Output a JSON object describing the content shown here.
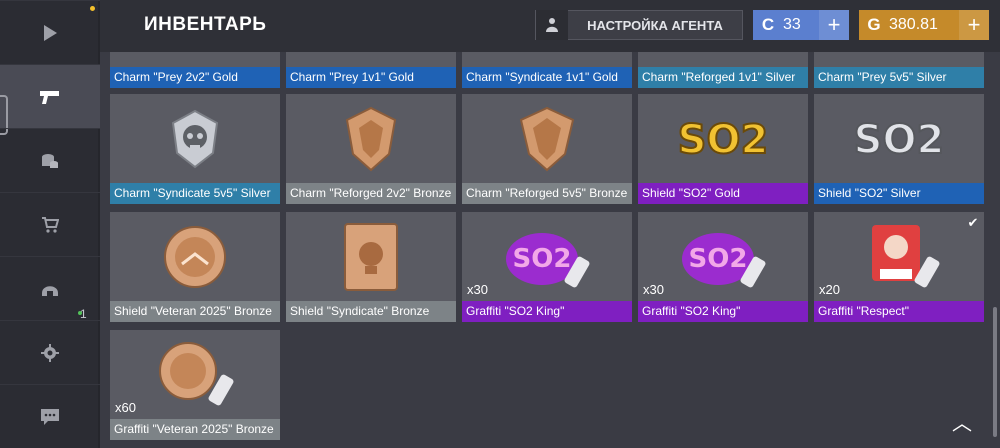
{
  "header": {
    "title": "ИНВЕНТАРЬ",
    "agent_button": "НАСТРОЙКА АГЕНТА",
    "currency_blue": "33",
    "currency_gold": "380.81",
    "blue_symbol": "C",
    "gold_symbol": "G",
    "plus": "+"
  },
  "sidebar": {
    "badge": "1",
    "items": [
      {
        "icon": "play-icon"
      },
      {
        "icon": "pistol-icon"
      },
      {
        "icon": "coins-icon"
      },
      {
        "icon": "cart-icon"
      },
      {
        "icon": "helmet-icon"
      },
      {
        "icon": "gear-icon"
      },
      {
        "icon": "chat-icon"
      }
    ]
  },
  "items_partial": [
    {
      "label": "Charm \"Prey 2v2\" Gold",
      "color": "#1f62b5"
    },
    {
      "label": "Charm \"Prey 1v1\" Gold",
      "color": "#1f62b5"
    },
    {
      "label": "Charm \"Syndicate 1v1\" Gold",
      "color": "#1f62b5"
    },
    {
      "label": "Charm \"Reforged 1v1\" Silver",
      "color": "#2f7fa8"
    },
    {
      "label": "Charm \"Prey 5v5\" Silver",
      "color": "#2f7fa8"
    }
  ],
  "items": [
    {
      "label": "Charm \"Syndicate 5v5\" Silver",
      "color": "#2f7fa8",
      "art": "silver-skull-charm",
      "qty": "",
      "check": ""
    },
    {
      "label": "Charm \"Reforged 2v2\" Bronze",
      "color": "#7d8387",
      "art": "bronze-shield-charm",
      "qty": "",
      "check": ""
    },
    {
      "label": "Charm \"Reforged 5v5\" Bronze",
      "color": "#7d8387",
      "art": "bronze-shield-charm",
      "qty": "",
      "check": ""
    },
    {
      "label": "Shield \"SO2\" Gold",
      "color": "#7f1fc1",
      "art": "so2-gold",
      "qty": "",
      "check": ""
    },
    {
      "label": "Shield \"SO2\" Silver",
      "color": "#1f62b5",
      "art": "so2-silver",
      "qty": "",
      "check": ""
    },
    {
      "label": "Shield \"Veteran 2025\" Bronze",
      "color": "#7d8387",
      "art": "veteran-badge",
      "qty": "",
      "check": ""
    },
    {
      "label": "Shield \"Syndicate\" Bronze",
      "color": "#7d8387",
      "art": "syndicate-plate",
      "qty": "",
      "check": ""
    },
    {
      "label": "Graffiti \"SO2 King\"",
      "color": "#7f1fc1",
      "art": "so2-king-graffiti",
      "qty": "x30",
      "check": ""
    },
    {
      "label": "Graffiti \"SO2 King\"",
      "color": "#7f1fc1",
      "art": "so2-king-graffiti",
      "qty": "x30",
      "check": ""
    },
    {
      "label": "Graffiti \"Respect\"",
      "color": "#7f1fc1",
      "art": "respect-graffiti",
      "qty": "x20",
      "check": "✔"
    },
    {
      "label": "Graffiti \"Veteran 2025\" Bronze",
      "color": "#7d8387",
      "art": "veteran-graffiti",
      "qty": "x60",
      "check": ""
    }
  ],
  "scroll_up": "︿"
}
